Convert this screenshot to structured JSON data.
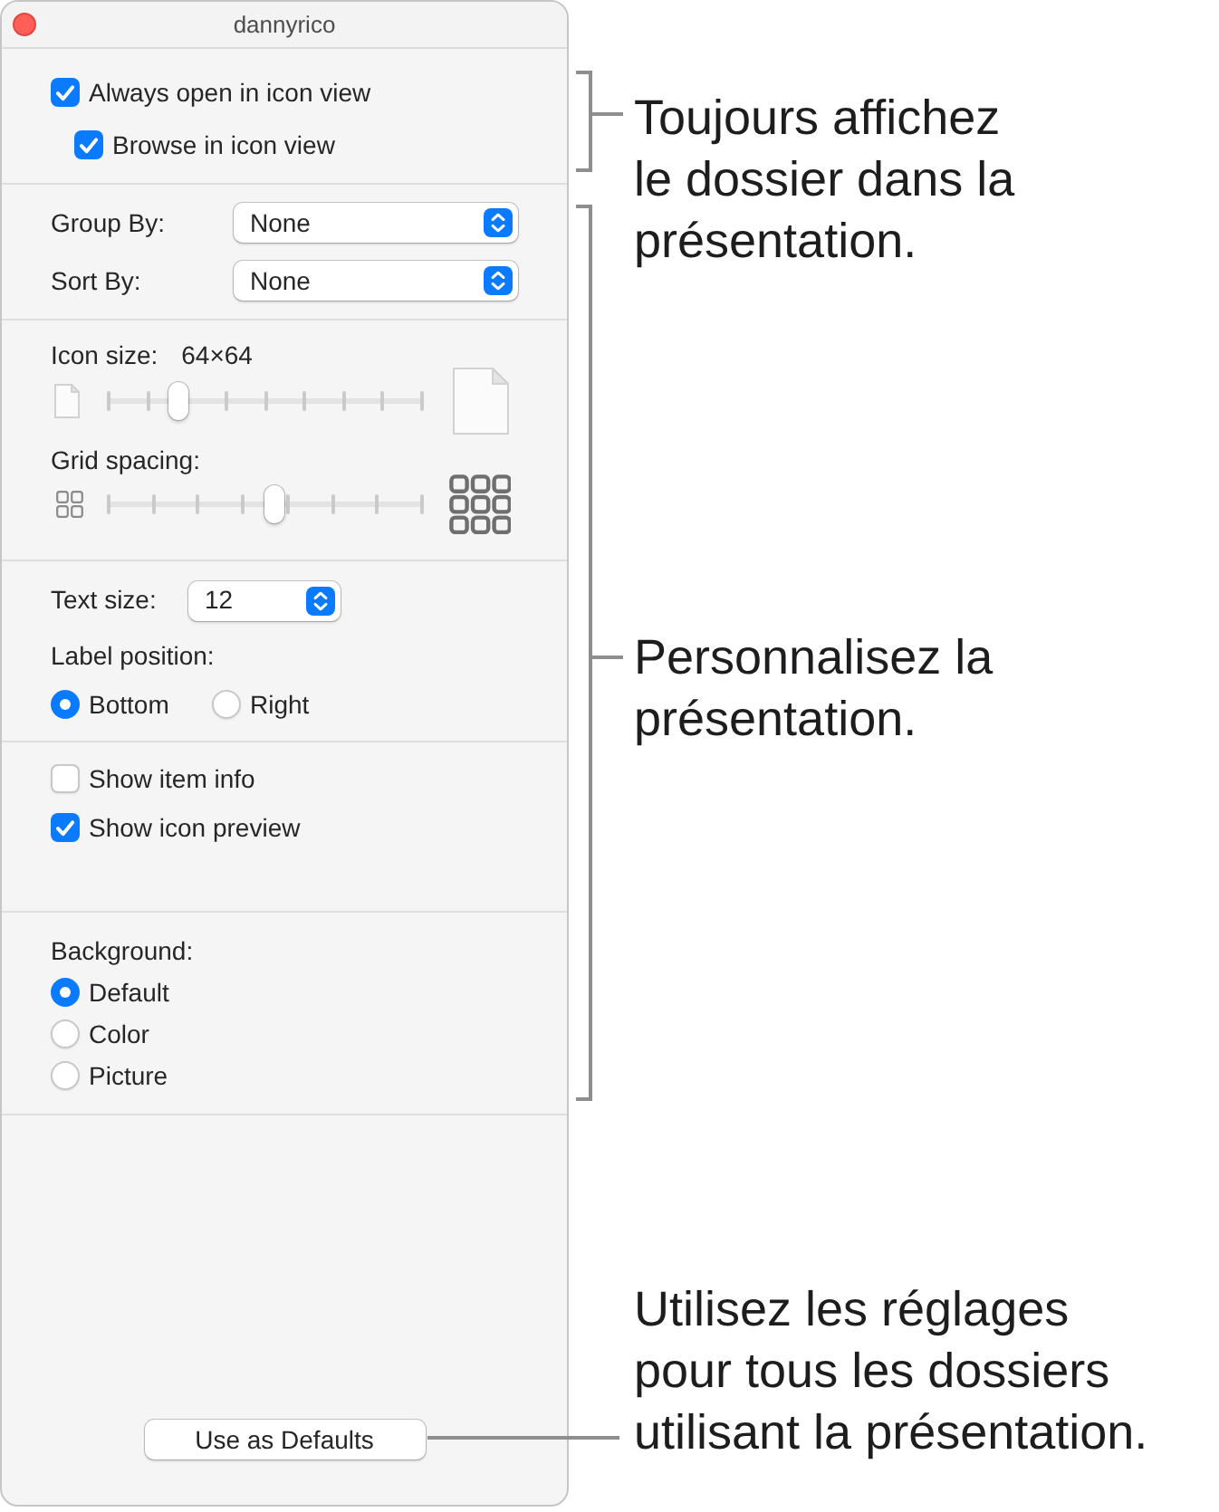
{
  "window": {
    "title": "dannyrico"
  },
  "view_options": [
    {
      "label": "Always open in icon view",
      "checked": true,
      "children": [
        {
          "label": "Browse in icon view",
          "checked": true
        }
      ]
    }
  ],
  "arrangement": [
    {
      "label": "Group By:",
      "value": "None"
    },
    {
      "label": "Sort By:",
      "value": "None"
    }
  ],
  "sliders": [
    {
      "kind": "size",
      "label": "Icon size:",
      "reading": "64×64",
      "level": 0.22
    },
    {
      "kind": "spacing",
      "label": "Grid spacing:",
      "level": 0.53
    }
  ],
  "text_size": {
    "label": "Text size:",
    "value": "12"
  },
  "label_position": {
    "label": "Label position:",
    "options": [
      {
        "label": "Bottom",
        "selected": true
      },
      {
        "label": "Right",
        "selected": false
      }
    ]
  },
  "item_options": [
    {
      "label": "Show item info",
      "checked": false
    },
    {
      "label": "Show icon preview",
      "checked": true
    }
  ],
  "background": {
    "label": "Background:",
    "options": [
      {
        "label": "Default",
        "selected": true
      },
      {
        "label": "Color",
        "selected": false
      },
      {
        "label": "Picture",
        "selected": false
      }
    ]
  },
  "button": {
    "label": "Use as Defaults"
  },
  "callouts": [
    {
      "kind": "bracket",
      "text": "Toujours affichez\nle dossier dans la\nprésentation."
    },
    {
      "kind": "bracket",
      "text": "Personnalisez la\nprésentation."
    },
    {
      "kind": "leader",
      "text": "Utilisez les réglages\npour tous les dossiers\nutilisant la présentation."
    }
  ]
}
